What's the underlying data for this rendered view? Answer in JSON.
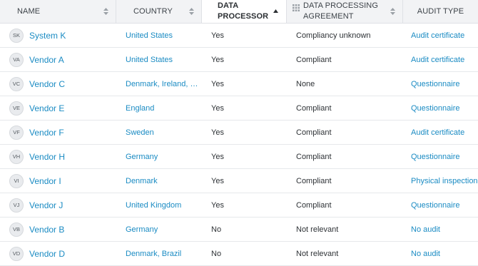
{
  "columns": {
    "name": "NAME",
    "country": "COUNTRY",
    "data_processor_line1": "DATA",
    "data_processor_line2": "PROCESSOR",
    "dpa_line1": "DATA PROCESSING",
    "dpa_line2": "AGREEMENT",
    "audit_type": "AUDIT TYPE"
  },
  "icons": {
    "sort": "sort-updown-icon",
    "sorted_asc": "sort-ascending-icon",
    "grid": "grid-icon"
  },
  "colors": {
    "link": "#1a8bc3",
    "header_bg": "#f2f3f5",
    "border": "#dfe1e5"
  },
  "rows": [
    {
      "initials": "SK",
      "name": "System K",
      "country": "United States",
      "processor": "Yes",
      "dpa": "Compliancy unknown",
      "audit": "Audit certificate"
    },
    {
      "initials": "VA",
      "name": "Vendor A",
      "country": "United States",
      "processor": "Yes",
      "dpa": "Compliant",
      "audit": "Audit certificate"
    },
    {
      "initials": "VC",
      "name": "Vendor C",
      "country": "Denmark, Ireland, En...",
      "processor": "Yes",
      "dpa": "None",
      "audit": "Questionnaire"
    },
    {
      "initials": "VE",
      "name": "Vendor E",
      "country": "England",
      "processor": "Yes",
      "dpa": "Compliant",
      "audit": "Questionnaire"
    },
    {
      "initials": "VF",
      "name": "Vendor F",
      "country": "Sweden",
      "processor": "Yes",
      "dpa": "Compliant",
      "audit": "Audit certificate"
    },
    {
      "initials": "VH",
      "name": "Vendor H",
      "country": "Germany",
      "processor": "Yes",
      "dpa": "Compliant",
      "audit": "Questionnaire"
    },
    {
      "initials": "VI",
      "name": "Vendor I",
      "country": "Denmark",
      "processor": "Yes",
      "dpa": "Compliant",
      "audit": "Physical inspection"
    },
    {
      "initials": "VJ",
      "name": "Vendor J",
      "country": "United Kingdom",
      "processor": "Yes",
      "dpa": "Compliant",
      "audit": "Questionnaire"
    },
    {
      "initials": "VB",
      "name": "Vendor B",
      "country": "Germany",
      "processor": "No",
      "dpa": "Not relevant",
      "audit": "No audit"
    },
    {
      "initials": "VD",
      "name": "Vendor D",
      "country": "Denmark, Brazil",
      "processor": "No",
      "dpa": "Not relevant",
      "audit": "No audit"
    }
  ]
}
